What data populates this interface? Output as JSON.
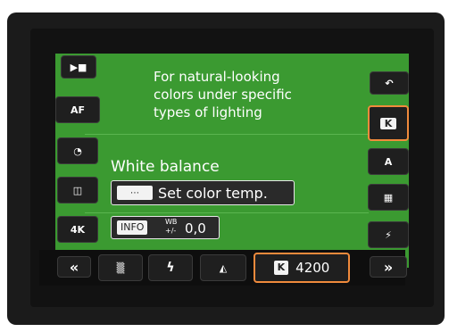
{
  "description": {
    "lines": [
      "For natural-looking",
      "colors under specific",
      "types of lighting"
    ]
  },
  "setting": {
    "title": "White balance",
    "mode_label": "Set color temp.",
    "info_label": "INFO",
    "wb_shift_label": "WB",
    "wb_shift_sub": "+/-",
    "wb_shift_value": "0,0"
  },
  "left_icons": [
    {
      "name": "movie-mode-icon",
      "glyph": "▶■"
    },
    {
      "name": "af-mode-icon",
      "glyph": "AF"
    },
    {
      "name": "drive-timer-icon",
      "glyph": "◔"
    },
    {
      "name": "metering-icon",
      "glyph": "◫"
    },
    {
      "name": "quality-icon",
      "glyph": "4K"
    }
  ],
  "right_icons": [
    {
      "name": "back-icon",
      "glyph": "↶"
    },
    {
      "name": "kelvin-icon",
      "glyph": "K"
    },
    {
      "name": "picture-style-icon",
      "glyph": "A"
    },
    {
      "name": "shooting-info-icon",
      "glyph": "▦"
    },
    {
      "name": "flash-off-icon",
      "glyph": "⚡"
    }
  ],
  "bottom": {
    "nav_left": "«",
    "nav_right": "»",
    "options": [
      {
        "name": "fluorescent-icon",
        "glyph": "▒"
      },
      {
        "name": "flash-icon",
        "glyph": "ϟ"
      },
      {
        "name": "custom-wb-icon",
        "glyph": "◭"
      }
    ],
    "selected_badge": "K",
    "selected_value": "4200"
  },
  "colors": {
    "panel_green": "#3b9a31",
    "selection_orange": "#f08a3c",
    "tile_dark": "#1f1f1f"
  }
}
